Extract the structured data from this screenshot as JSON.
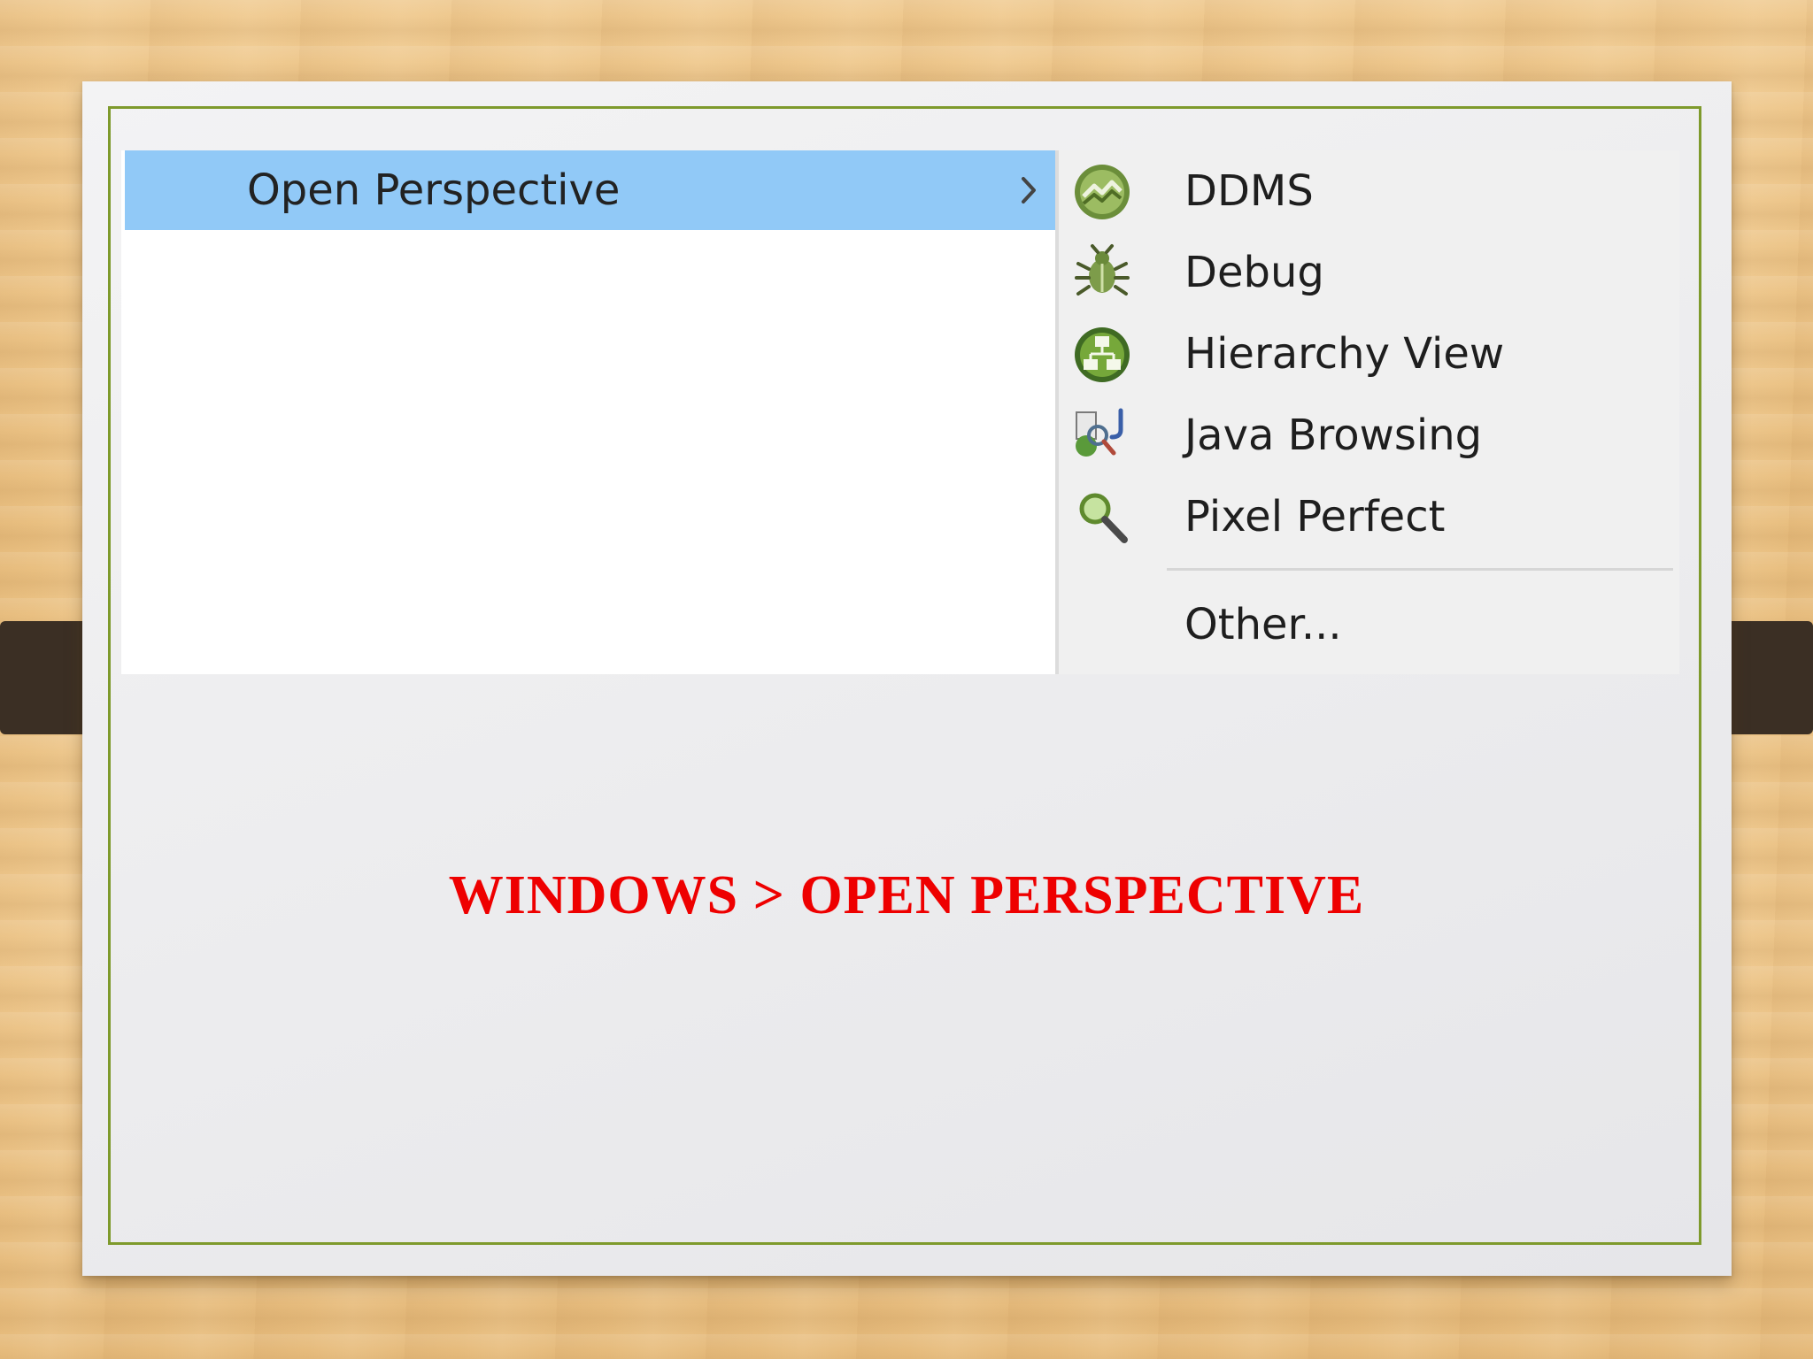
{
  "menu": {
    "main_item": {
      "label": "Open Perspective",
      "submenu_icon": "chevron-right-icon"
    },
    "submenu": {
      "items": [
        {
          "label": "DDMS",
          "icon": "ddms-icon"
        },
        {
          "label": "Debug",
          "icon": "bug-icon"
        },
        {
          "label": "Hierarchy View",
          "icon": "hierarchy-view-icon"
        },
        {
          "label": "Java Browsing",
          "icon": "java-browsing-icon"
        },
        {
          "label": "Pixel Perfect",
          "icon": "magnifier-icon"
        }
      ],
      "other_label": "Other..."
    }
  },
  "caption": "WINDOWS > OPEN PERSPECTIVE",
  "colors": {
    "highlight": "#91c9f7",
    "caption": "#ee0000",
    "frame": "#7e9a2c"
  }
}
